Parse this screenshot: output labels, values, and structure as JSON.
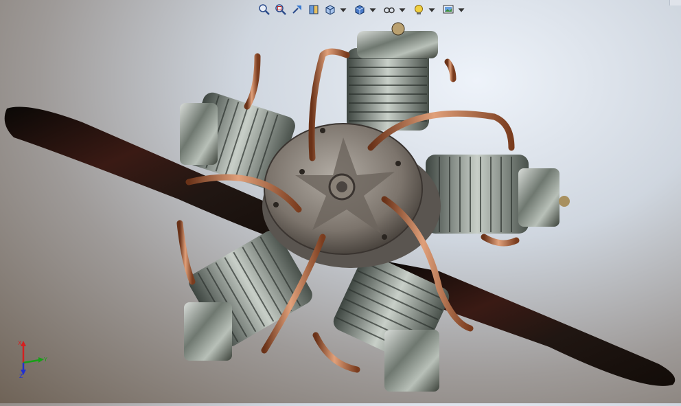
{
  "toolbar": {
    "buttons": [
      {
        "icon": "zoom-to-fit-icon"
      },
      {
        "icon": "zoom-to-area-icon"
      },
      {
        "icon": "previous-view-icon"
      },
      {
        "icon": "section-view-icon"
      },
      {
        "icon": "view-orientation-icon",
        "dropdown": true
      },
      {
        "icon": "display-style-icon",
        "dropdown": true
      },
      {
        "icon": "hide-show-items-icon",
        "dropdown": true
      },
      {
        "icon": "edit-appearance-icon",
        "dropdown": true
      },
      {
        "icon": "apply-scene-icon",
        "dropdown": true
      }
    ]
  },
  "triad": {
    "x_label": "Y",
    "y_label": "X",
    "z_label": "Z"
  },
  "colors": {
    "copper": "#b76a3e",
    "steel": "#8f9aa0",
    "propeller": "#1c1410",
    "axis_x": "#d42020",
    "axis_y": "#18a018",
    "axis_z": "#2030d0"
  }
}
